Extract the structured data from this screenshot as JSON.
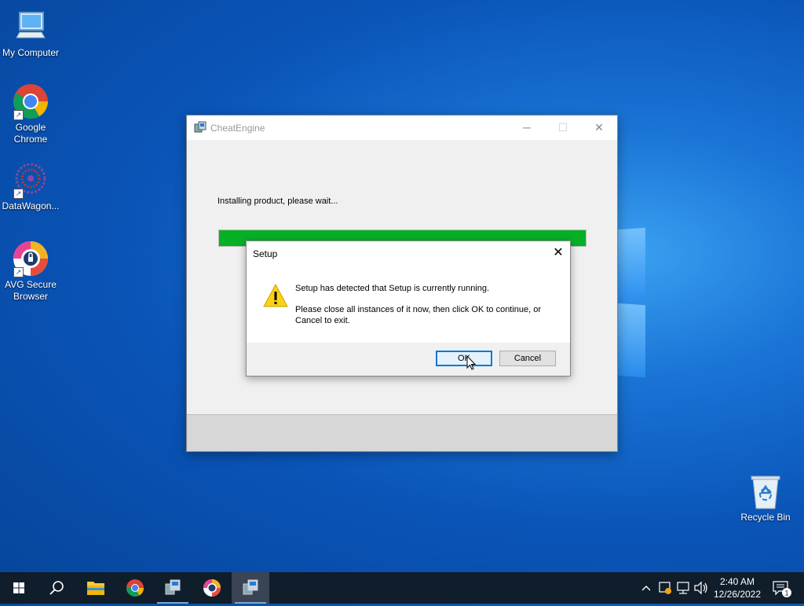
{
  "desktop": {
    "icons": [
      {
        "label": "My Computer",
        "icon": "computer-icon"
      },
      {
        "label": "Google Chrome",
        "icon": "chrome-icon"
      },
      {
        "label": "DataWagon...",
        "icon": "datawagon-icon"
      },
      {
        "label": "AVG Secure Browser",
        "icon": "avg-browser-icon"
      },
      {
        "label": "Recycle Bin",
        "icon": "recycle-bin-icon"
      }
    ]
  },
  "installer": {
    "title": "CheatEngine",
    "message": "Installing product, please wait...",
    "progress": 1.0
  },
  "dialog": {
    "title": "Setup",
    "line1": "Setup has detected that Setup is currently running.",
    "line2": "Please close all instances of it now, then click OK to continue, or Cancel to exit.",
    "ok_label": "OK",
    "cancel_label": "Cancel"
  },
  "taskbar": {
    "time": "2:40 AM",
    "date": "12/26/2022",
    "notification_count": "1"
  },
  "colors": {
    "progress": "#06b025",
    "accent": "#0078d7",
    "taskbar": "#101d2b"
  }
}
